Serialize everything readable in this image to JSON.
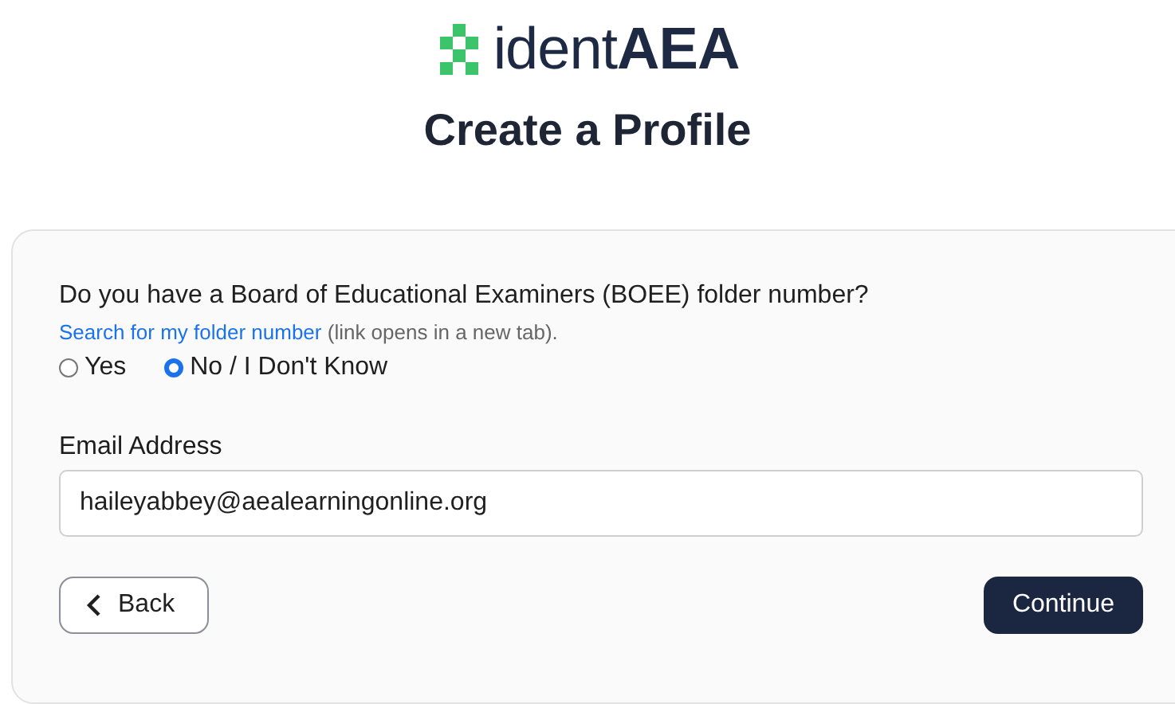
{
  "logo": {
    "text": "ident**AEA**"
  },
  "title": "Create a Profile",
  "form": {
    "question": "Do you have a Board of Educational Examiners (BOEE) folder number?",
    "link": "Search for my folder number",
    "link_note": "(link opens in a new tab).",
    "options": [
      {
        "label": "Yes",
        "selected": false
      },
      {
        "label": "No / I Don't Know",
        "selected": true
      }
    ],
    "email_label": "Email Address",
    "email_value": "haileyabbey@aealearningonline.org"
  },
  "buttons": [
    {
      "kind": "back",
      "label": "Back"
    },
    {
      "kind": "primary",
      "label": "Continue"
    }
  ]
}
